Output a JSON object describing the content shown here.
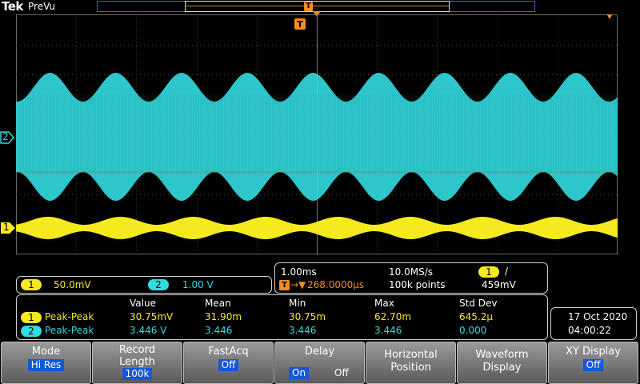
{
  "header": {
    "brand": "Tek",
    "mode": "PreVu",
    "trigger_marker": "T"
  },
  "channels": [
    {
      "id": "1",
      "marker": "1",
      "scale": "50.0mV",
      "color": "#f5ea1e"
    },
    {
      "id": "2",
      "marker": "2",
      "scale": "1.00 V",
      "color": "#32dbe0"
    }
  ],
  "horizontal": {
    "time_div": "1.00ms",
    "sample_rate": "10.0MS/s",
    "trigger_delay": "268.0000µs",
    "record": "100k points",
    "trigger_channel": "1",
    "trigger_slope": "/",
    "trigger_level": "459mV",
    "delay_prefix": "T→▼"
  },
  "measurements": {
    "headers": [
      "Value",
      "Mean",
      "Min",
      "Max",
      "Std Dev"
    ],
    "rows": [
      {
        "ch": "1",
        "name": "Peak-Peak",
        "value": "30.75mV",
        "mean": "31.90m",
        "min": "30.75m",
        "max": "62.70m",
        "std": "645.2µ"
      },
      {
        "ch": "2",
        "name": "Peak-Peak",
        "value": "3.446 V",
        "mean": "3.446",
        "min": "3.446",
        "max": "3.446",
        "std": "0.000"
      }
    ]
  },
  "datetime": {
    "date": "17 Oct  2020",
    "time": "04:00:22"
  },
  "softkeys": [
    {
      "label": "Mode",
      "value": "Hi Res"
    },
    {
      "label": "Record Length",
      "value": "100k"
    },
    {
      "label": "FastAcq",
      "value": "Off"
    },
    {
      "label": "Delay",
      "on": "On",
      "off": "Off"
    },
    {
      "label": "Horizontal Position",
      "value": ""
    },
    {
      "label": "Waveform Display",
      "value": ""
    },
    {
      "label": "XY Display",
      "value": "Off"
    }
  ],
  "colors": {
    "ch1": "#f5ea1e",
    "ch2": "#32dbe0",
    "trigger": "#f28c1e",
    "softkey_value": "#1458d8"
  }
}
